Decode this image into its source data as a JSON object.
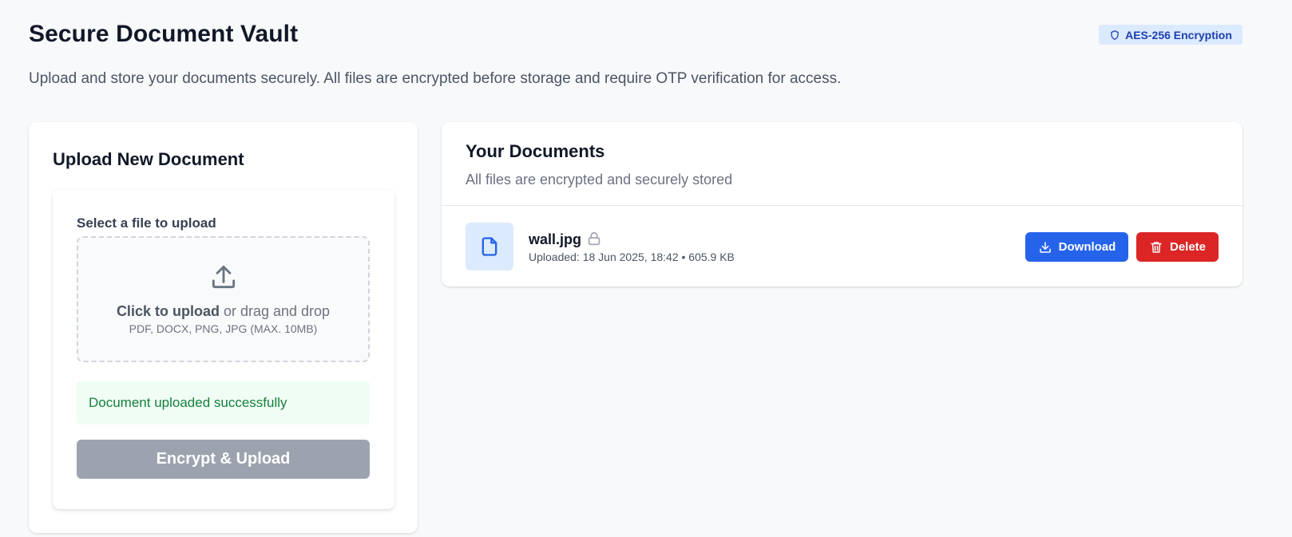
{
  "header": {
    "title": "Secure Document Vault",
    "badge": "AES-256 Encryption",
    "badge_icon": "shield-icon",
    "subtitle": "Upload and store your documents securely. All files are encrypted before storage and require OTP verification for access."
  },
  "upload": {
    "title": "Upload New Document",
    "select_label": "Select a file to upload",
    "dropzone": {
      "icon": "upload-icon",
      "click_text": "Click to upload",
      "drag_text": " or drag and drop",
      "formats": "PDF, DOCX, PNG, JPG (MAX. 10MB)"
    },
    "success_message": "Document uploaded successfully",
    "submit_label": "Encrypt & Upload"
  },
  "documents": {
    "title": "Your Documents",
    "subtitle": "All files are encrypted and securely stored",
    "items": [
      {
        "name": "wall.jpg",
        "icon": "file-icon",
        "locked": true,
        "meta": "Uploaded: 18 Jun 2025, 18:42 • 605.9 KB",
        "download_label": "Download",
        "delete_label": "Delete"
      }
    ]
  },
  "colors": {
    "primary": "#2563eb",
    "danger": "#dc2626",
    "success_bg": "#f0fdf4",
    "success_text": "#15803d",
    "disabled": "#9ca3af",
    "badge_bg": "#dbeafe"
  }
}
